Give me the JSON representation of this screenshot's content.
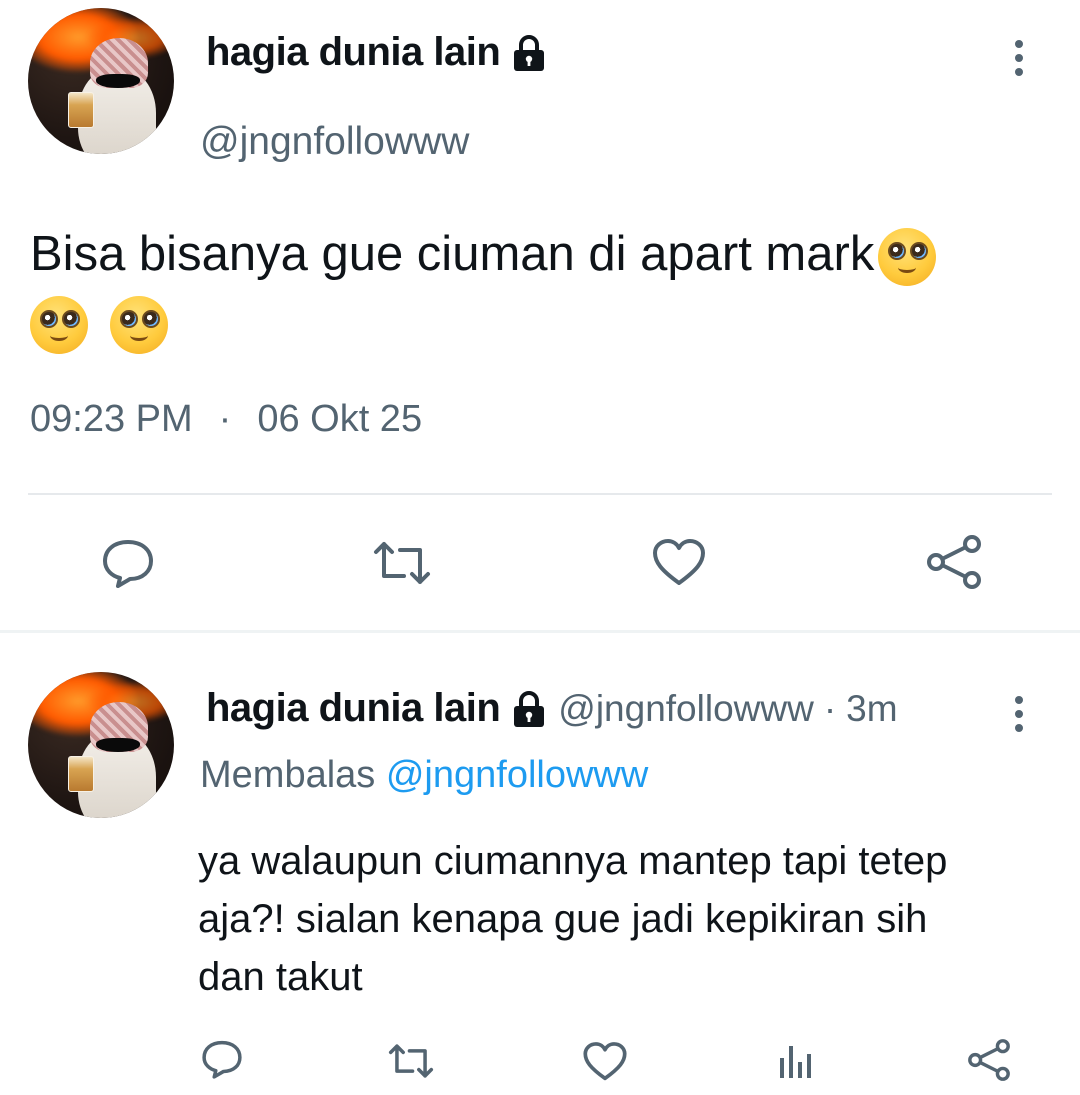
{
  "main_tweet": {
    "display_name": "hagia dunia lain",
    "handle": "@jngnfollowww",
    "text": "Bisa bisanya gue ciuman di apart mark",
    "time": "09:23 PM",
    "dot": "·",
    "date": "06 Okt 25",
    "emoji_icon": "pleading-face-emoji"
  },
  "reply_tweet": {
    "display_name": "hagia dunia lain",
    "handle": "@jngnfollowww",
    "dot": "·",
    "age": "3m",
    "replying_label": "Membalas",
    "replying_to": "@jngnfollowww",
    "text_line1": "ya walaupun ciumannya mantep tapi tetep",
    "text_line2": "aja?! sialan kenapa gue jadi kepikiran sih",
    "text_line3": "dan takut"
  },
  "colors": {
    "text": "#0f1419",
    "muted": "#536471",
    "link": "#1d9bf0",
    "divider": "#e6e9ec"
  }
}
